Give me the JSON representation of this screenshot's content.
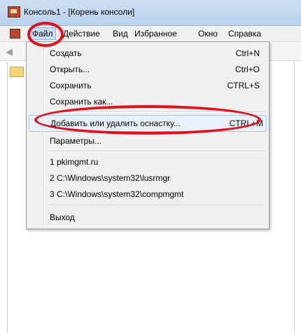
{
  "window": {
    "title": "Консоль1 - [Корень консоли]"
  },
  "menubar": {
    "items": [
      {
        "label": "Файл"
      },
      {
        "label": "Действие"
      },
      {
        "label": "Вид"
      },
      {
        "label": "Избранное"
      },
      {
        "label": "Окно"
      },
      {
        "label": "Справка"
      }
    ]
  },
  "file_menu": {
    "items": [
      {
        "label": "Создать",
        "shortcut": "Ctrl+N"
      },
      {
        "label": "Открыть...",
        "shortcut": "Ctrl+O"
      },
      {
        "label": "Сохранить",
        "shortcut": "CTRL+S"
      },
      {
        "label": "Сохранить как...",
        "shortcut": ""
      },
      {
        "label": "Добавить или удалить оснастку...",
        "shortcut": "CTRL+M"
      },
      {
        "label": "Параметры...",
        "shortcut": ""
      },
      {
        "label": "1 pkimgmt.ru",
        "shortcut": ""
      },
      {
        "label": "2 C:\\Windows\\system32\\lusrmgr",
        "shortcut": ""
      },
      {
        "label": "3 C:\\Windows\\system32\\compmgmt",
        "shortcut": ""
      },
      {
        "label": "Выход",
        "shortcut": ""
      }
    ]
  },
  "annotations": {
    "color": "#e3101b"
  }
}
